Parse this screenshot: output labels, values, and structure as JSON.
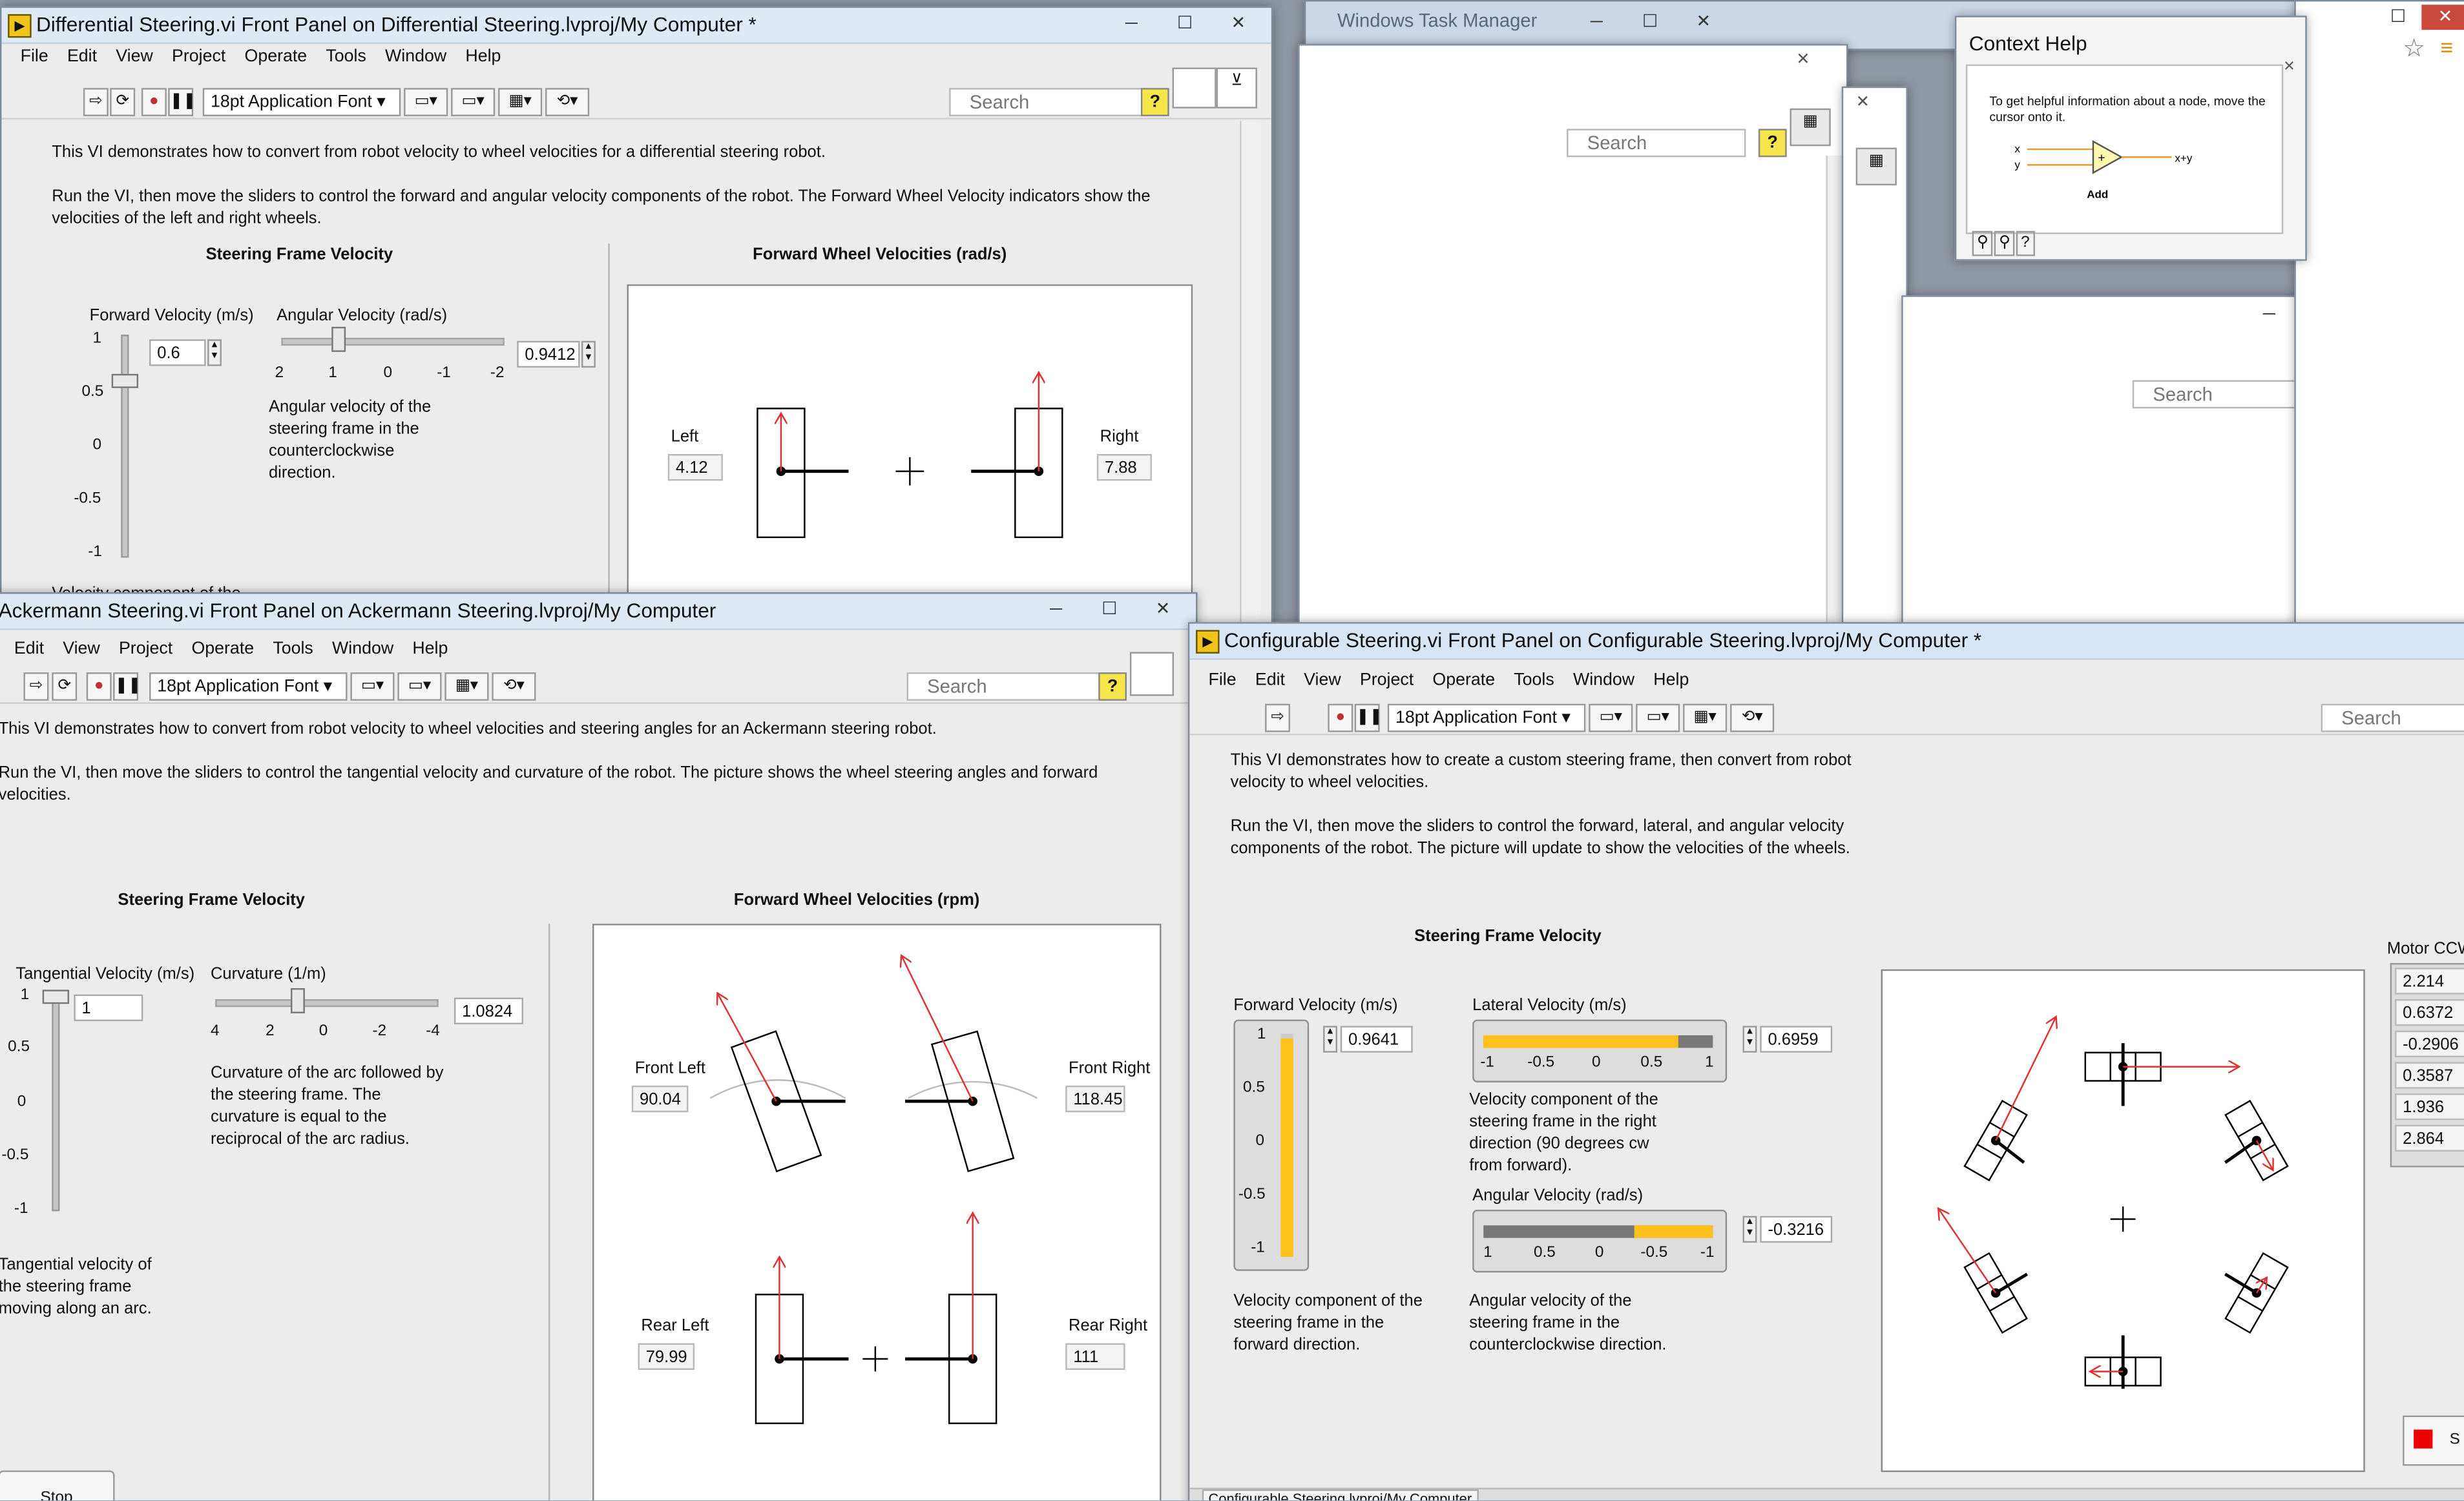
{
  "colors": {
    "accent_red": "#e03030",
    "fill_orange": "#ffc21c",
    "lv_yellow": "#f0c419"
  },
  "icons": [
    "labview-vi-icon",
    "run-arrow-icon",
    "run-continuous-icon",
    "abort-icon",
    "pause-icon",
    "search-icon",
    "help-icon",
    "minimize-icon",
    "maximize-icon",
    "close-icon",
    "star-icon"
  ],
  "menu": {
    "file": "File",
    "edit": "Edit",
    "view": "View",
    "project": "Project",
    "operate": "Operate",
    "tools": "Tools",
    "window": "Window",
    "help": "Help"
  },
  "common": {
    "font_selector": "18pt Application Font",
    "search_placeholder": "Search",
    "help_glyph": "?"
  },
  "taskmanager": {
    "title": "Windows Task Manager"
  },
  "context_help": {
    "title": "Context Help",
    "text": "To get helpful information about a node, move the cursor onto it.",
    "node_label": "Add",
    "in_x": "x",
    "in_y": "y",
    "out": "x+y"
  },
  "differential": {
    "title": "Differential Steering.vi Front Panel on Differential Steering.lvproj/My Computer *",
    "desc1": "This VI demonstrates how to convert from robot velocity to wheel velocities for a differential steering robot.",
    "desc2": "Run the VI, then move the sliders to control the forward and angular velocity components of the robot.  The Forward Wheel Velocity indicators show the velocities of the left and right wheels.",
    "frame_heading": "Steering Frame Velocity",
    "wheel_heading": "Forward Wheel Velocities (rad/s)",
    "fwd_label": "Forward Velocity (m/s)",
    "fwd_value": "0.6",
    "fwd_level": 0.6,
    "fwd_ticks": [
      "1",
      "0.5",
      "0",
      "-0.5",
      "-1"
    ],
    "ang_label": "Angular Velocity (rad/s)",
    "ang_value": "0.9412",
    "ang_ticks": [
      "2",
      "1",
      "0",
      "-1",
      "-2"
    ],
    "ang_desc": "Angular velocity of the steering frame in the counterclockwise direction.",
    "fwd_desc_partial": "Velocity component of the",
    "left_label": "Left",
    "left_value": "4.12",
    "right_label": "Right",
    "right_value": "7.88"
  },
  "ackermann": {
    "title": "Ackermann Steering.vi Front Panel on Ackermann Steering.lvproj/My Computer",
    "desc1": "This VI demonstrates how to convert from robot velocity to wheel velocities and steering angles for an Ackermann steering robot.",
    "desc2": "Run the VI, then move the sliders to control the tangential velocity and curvature of the robot.  The picture shows the wheel steering angles and forward velocities.",
    "frame_heading": "Steering Frame Velocity",
    "wheel_heading": "Forward Wheel Velocities (rpm)",
    "tan_label": "Tangential Velocity (m/s)",
    "tan_value": "1",
    "tan_ticks": [
      "1",
      "0.5",
      "0",
      "-0.5",
      "-1"
    ],
    "tan_desc": "Tangential velocity of the steering frame moving along an arc.",
    "curv_label": "Curvature (1/m)",
    "curv_value": "1.0824",
    "curv_ticks": [
      "4",
      "2",
      "0",
      "-2",
      "-4"
    ],
    "curv_desc": "Curvature of the arc followed by the steering frame.  The curvature is equal to the reciprocal of the arc radius.",
    "front_left_label": "Front Left",
    "front_left_value": "90.04",
    "front_right_label": "Front Right",
    "front_right_value": "118.45",
    "rear_left_label": "Rear Left",
    "rear_left_value": "79.99",
    "rear_right_label": "Rear Right",
    "rear_right_value": "111",
    "stop_label": "Stop"
  },
  "configurable": {
    "title": "Configurable Steering.vi Front Panel on Configurable Steering.lvproj/My Computer *",
    "desc1": "This VI demonstrates how to create a custom steering frame, then convert from robot velocity to wheel velocities.",
    "desc2": "Run the VI, then move the sliders to control the forward, lateral, and angular velocity components of the robot.  The picture will update to show the velocities of the wheels.",
    "frame_heading": "Steering Frame Velocity",
    "fwd_label": "Forward Velocity (m/s)",
    "fwd_value": "0.9641",
    "fwd_level": 0.9641,
    "fwd_ticks": [
      "1",
      "0.5",
      "0",
      "-0.5",
      "-1"
    ],
    "fwd_desc": "Velocity component of the steering frame in the forward direction.",
    "lat_label": "Lateral Velocity (m/s)",
    "lat_value": "0.6959",
    "lat_ticks": [
      "-1",
      "-0.5",
      "0",
      "0.5",
      "1"
    ],
    "lat_desc": "Velocity component of the steering frame in the right direction (90 degrees cw from forward).",
    "ang_label": "Angular Velocity (rad/s)",
    "ang_value": "-0.3216",
    "ang_ticks": [
      "1",
      "0.5",
      "0",
      "-0.5",
      "-1"
    ],
    "ang_desc": "Angular velocity of the steering frame in the counterclockwise direction.",
    "motor_label": "Motor CCW",
    "motor_values": [
      "2.214",
      "0.6372",
      "-0.2906",
      "0.3587",
      "1.936",
      "2.864"
    ],
    "stop_label": "S",
    "status_tab": "Configurable Steering.lvproj/My Computer"
  }
}
